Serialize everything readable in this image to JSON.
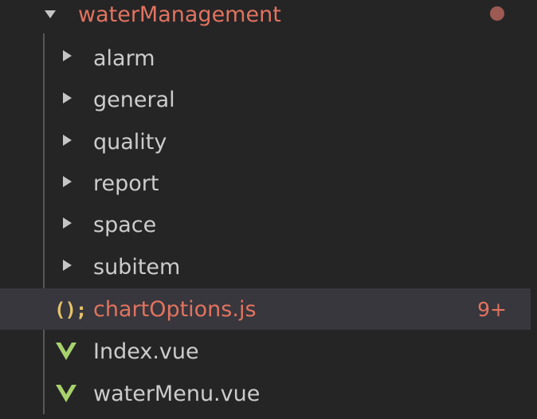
{
  "explorer": {
    "folder": {
      "label": "waterManagement",
      "icon": "chevron-down-icon",
      "status_color": "#9c5a52"
    },
    "children": [
      {
        "label": "alarm",
        "type": "folder",
        "icon": "chevron-right-icon"
      },
      {
        "label": "general",
        "type": "folder",
        "icon": "chevron-right-icon"
      },
      {
        "label": "quality",
        "type": "folder",
        "icon": "chevron-right-icon"
      },
      {
        "label": "report",
        "type": "folder",
        "icon": "chevron-right-icon"
      },
      {
        "label": "space",
        "type": "folder",
        "icon": "chevron-right-icon"
      },
      {
        "label": "subitem",
        "type": "folder",
        "icon": "chevron-right-icon"
      },
      {
        "label": "chartOptions.js",
        "type": "file",
        "icon": "js-file-icon",
        "icon_text": "();",
        "badge": "9+",
        "selected": true
      },
      {
        "label": "Index.vue",
        "type": "file",
        "icon": "vue-file-icon"
      },
      {
        "label": "waterMenu.vue",
        "type": "file",
        "icon": "vue-file-icon"
      }
    ]
  },
  "colors": {
    "background": "#252526",
    "selected_row": "#37373d",
    "text": "#cccccc",
    "modified_text": "#e2735f",
    "js_icon": "#e8c36a",
    "vue_icon": "#a8d26d"
  }
}
